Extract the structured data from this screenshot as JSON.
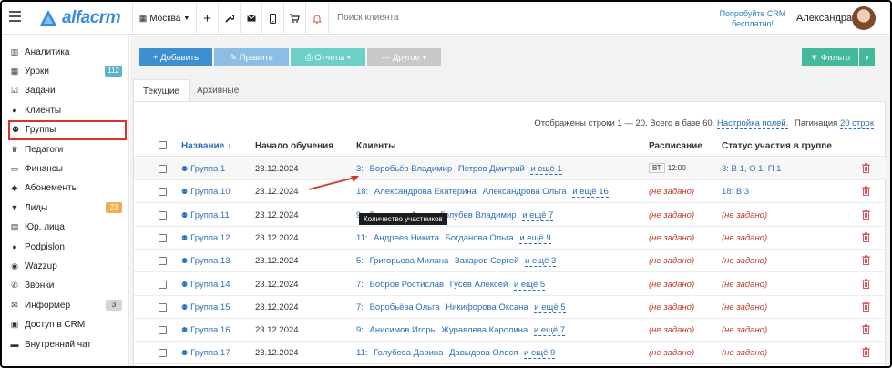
{
  "header": {
    "logo_text": "alfacrm",
    "city": "Москва",
    "plus": "+",
    "search_placeholder": "Поиск клиента",
    "promo": "Попробуйте CRM бесплатно!",
    "user_name": "Александра"
  },
  "sidebar": {
    "items": [
      {
        "label": "Аналитика",
        "icon": "analytics-icon"
      },
      {
        "label": "Уроки",
        "icon": "calendar-icon",
        "badge": "112"
      },
      {
        "label": "Задачи",
        "icon": "tasks-icon"
      },
      {
        "label": "Клиенты",
        "icon": "user-icon"
      },
      {
        "label": "Группы",
        "icon": "group-icon",
        "active": true
      },
      {
        "label": "Педагоги",
        "icon": "teacher-icon"
      },
      {
        "label": "Финансы",
        "icon": "money-icon"
      },
      {
        "label": "Абонементы",
        "icon": "tag-icon"
      },
      {
        "label": "Лиды",
        "icon": "funnel-icon",
        "badge": "23"
      },
      {
        "label": "Юр. лица",
        "icon": "building-icon"
      },
      {
        "label": "Podpislon",
        "icon": "person-icon"
      },
      {
        "label": "Wazzup",
        "icon": "whatsapp-icon"
      },
      {
        "label": "Звонки",
        "icon": "phone-icon"
      },
      {
        "label": "Информер",
        "icon": "envelope-icon",
        "badge": "3"
      },
      {
        "label": "Доступ в CRM",
        "icon": "lock-icon"
      },
      {
        "label": "Внутренний чат",
        "icon": "chat-icon"
      }
    ]
  },
  "toolbar": {
    "add": "+ Добавить",
    "edit": "✎ Править",
    "reports": "⎙ Отчеты ▾",
    "other": "— Другое ▾",
    "filter": "▼ Фильтр",
    "filter_caret": "▾"
  },
  "tabs": {
    "current": "Текущие",
    "archive": "Архивные"
  },
  "pager": {
    "text": "Отображены строки 1 — 20. Всего в базе 60.",
    "settings_link": "Настройка полей.",
    "pagination_label": "Пагинация",
    "pagination_link": "20 строк"
  },
  "table": {
    "headers": {
      "name": "Название ↓",
      "start": "Начало обучения",
      "clients": "Клиенты",
      "schedule": "Расписание",
      "status": "Статус участия в группе"
    },
    "rows": [
      {
        "name": "Группа 1",
        "date": "23.12.2024",
        "count": "3:",
        "c1": "Воробьёв Владимир",
        "c2": "Петров Дмитрий",
        "more": "и ещё 1",
        "sched_day": "ВТ",
        "sched_time": "12:00",
        "status": "3:  В 1, О 1, П 1"
      },
      {
        "name": "Группа 10",
        "date": "23.12.2024",
        "count": "18:",
        "c1": "Александрова Екатерина",
        "c2": "Александрова Ольга",
        "more": "и ещё 16",
        "sched_notset": "(не задано)",
        "status": "18:  В 3"
      },
      {
        "name": "Группа 11",
        "date": "23.12.2024",
        "count": "9:",
        "c1": "Васильев Артур",
        "c2": "Голубев Владимир",
        "more": "и ещё 7",
        "sched_notset": "(не задано)",
        "status_notset": "(не задано)"
      },
      {
        "name": "Группа 12",
        "date": "23.12.2024",
        "count": "11:",
        "c1": "Андреев Никита",
        "c2": "Богданова Ольга",
        "more": "и ещё 9",
        "sched_notset": "(не задано)",
        "status_notset": "(не задано)"
      },
      {
        "name": "Группа 13",
        "date": "23.12.2024",
        "count": "5:",
        "c1": "Григорьева Милана",
        "c2": "Захаров Сергей",
        "more": "и ещё 3",
        "sched_notset": "(не задано)",
        "status_notset": "(не задано)"
      },
      {
        "name": "Группа 14",
        "date": "23.12.2024",
        "count": "7:",
        "c1": "Бобров Ростислав",
        "c2": "Гусев Алексей",
        "more": "и ещё 5",
        "sched_notset": "(не задано)",
        "status_notset": "(не задано)"
      },
      {
        "name": "Группа 15",
        "date": "23.12.2024",
        "count": "7:",
        "c1": "Воробьёва Ольга",
        "c2": "Никифорова Оксана",
        "more": "и ещё 5",
        "sched_notset": "(не задано)",
        "status_notset": "(не задано)"
      },
      {
        "name": "Группа 16",
        "date": "23.12.2024",
        "count": "9:",
        "c1": "Анисимов Игорь",
        "c2": "Журавлева Каролина",
        "more": "и ещё 7",
        "sched_notset": "(не задано)",
        "status_notset": "(не задано)"
      },
      {
        "name": "Группа 17",
        "date": "23.12.2024",
        "count": "11:",
        "c1": "Голубева Дарина",
        "c2": "Давыдова Олеся",
        "more": "и ещё 9",
        "sched_notset": "(не задано)",
        "status_notset": "(не задано)"
      }
    ]
  },
  "tooltip": "Количество участников",
  "colors": {
    "accent_blue": "#3c8fd1",
    "link": "#2a6ebb",
    "highlight_red": "#d9332b",
    "filter_green": "#42b99a"
  }
}
